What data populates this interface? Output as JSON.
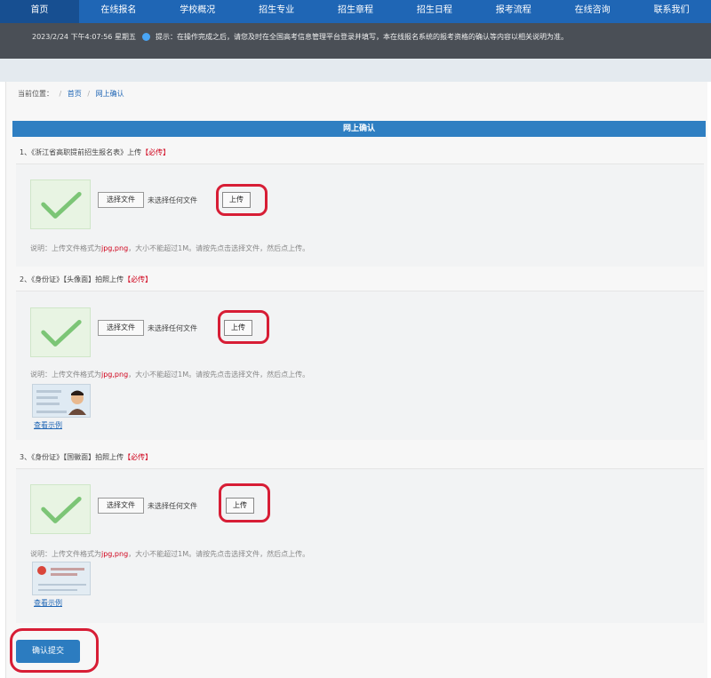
{
  "nav": {
    "items": [
      "首页",
      "在线报名",
      "学校概况",
      "招生专业",
      "招生章程",
      "招生日程",
      "报考流程",
      "在线咨询",
      "联系我们"
    ]
  },
  "ticker": {
    "date": "2023/2/24 下午4:07:56 星期五",
    "notice": "提示：在操作完成之后，请您及时在全国高考信息管理平台登录并填写，本在线报名系统的报考资格的确认等内容以相关说明为准。"
  },
  "breadcrumb": {
    "prefix": "当前位置：",
    "home": "首页",
    "current": "网上确认"
  },
  "section": {
    "title": "网上确认"
  },
  "uploads": [
    {
      "label": "1、《浙江省高职提前招生报名表》上传",
      "required": "【必传】",
      "choose_label": "选择文件",
      "file_status": "未选择任何文件",
      "upload_label": "上传",
      "hint_pre": "说明：上传文件格式为",
      "hint_fmt": "jpg,png",
      "hint_post": "，大小不能超过1M。请按先点击选择文件，然后点上传。",
      "example": ""
    },
    {
      "label": "2、《身份证》【头像面】拍照上传",
      "required": "【必传】",
      "choose_label": "选择文件",
      "file_status": "未选择任何文件",
      "upload_label": "上传",
      "hint_pre": "说明：上传文件格式为",
      "hint_fmt": "jpg,png",
      "hint_post": "，大小不能超过1M。请按先点击选择文件，然后点上传。",
      "example": "查看示例"
    },
    {
      "label": "3、《身份证》【国徽面】拍照上传",
      "required": "【必传】",
      "choose_label": "选择文件",
      "file_status": "未选择任何文件",
      "upload_label": "上传",
      "hint_pre": "说明：上传文件格式为",
      "hint_fmt": "jpg,png",
      "hint_post": "，大小不能超过1M。请按先点击选择文件，然后点上传。",
      "example": "查看示例"
    }
  ],
  "submit_label": "确认提交",
  "colors": {
    "nav": "#1f66b5",
    "section": "#2f7fc2",
    "required": "#d0021b",
    "highlight": "#d71d35"
  }
}
